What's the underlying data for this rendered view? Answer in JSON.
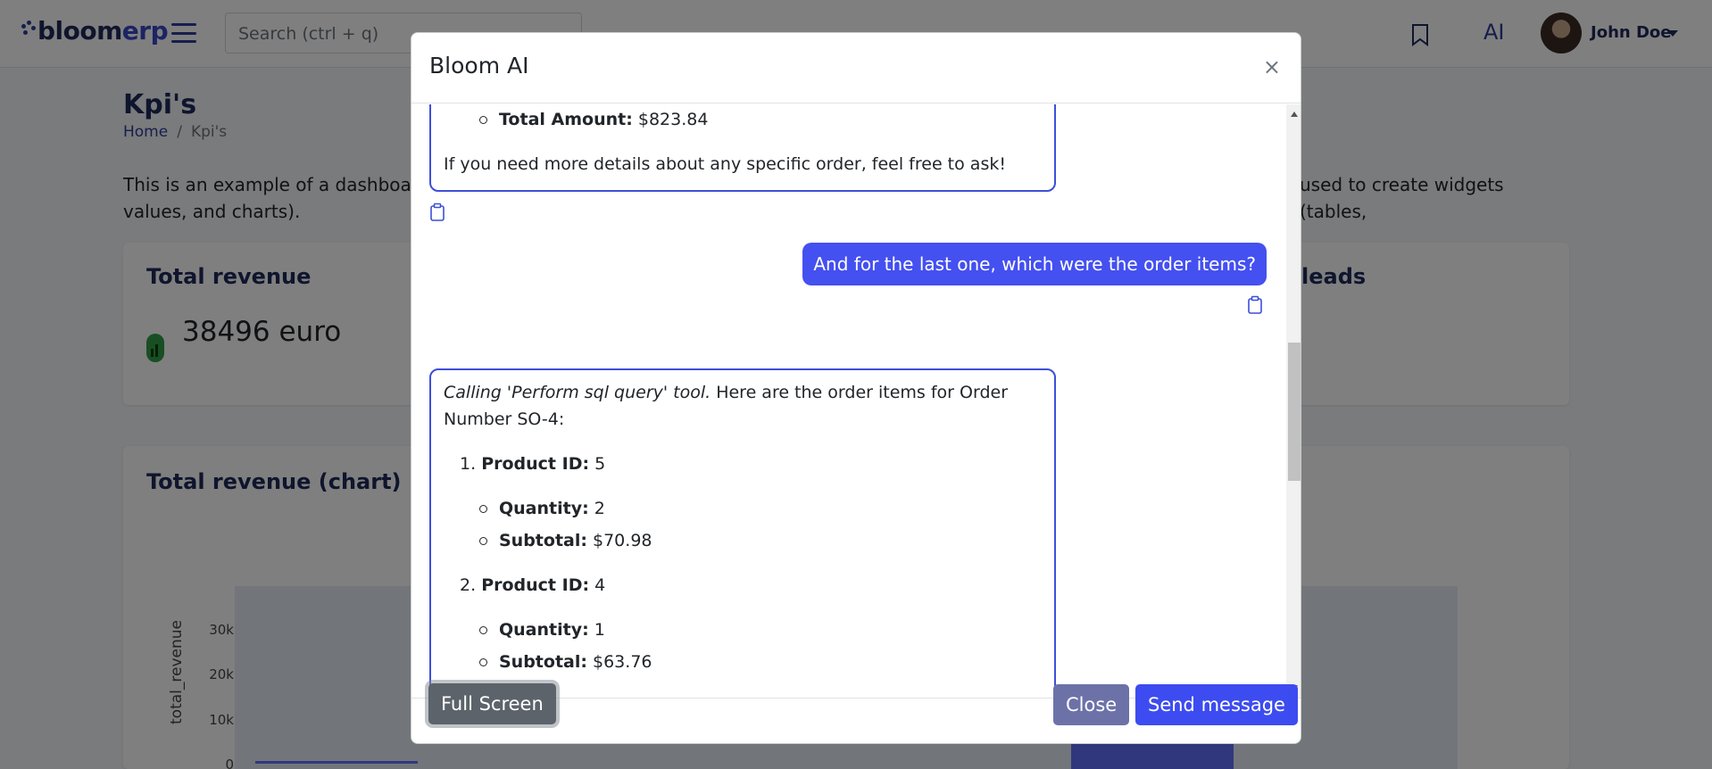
{
  "topbar": {
    "logo_main": "bloom",
    "logo_accent": "erp",
    "search_placeholder": "Search (ctrl + q)",
    "ai_label": "AI",
    "user_name": "John Doe"
  },
  "page": {
    "title": "Kpi's",
    "breadcrumb": [
      "Home",
      "/",
      "Kpi's"
    ],
    "intro_left": "This is an example of a dashboard",
    "intro_right": "used to create widgets (tables,",
    "intro_line2": "values, and charts)."
  },
  "cards": {
    "total_revenue_title": "Total revenue",
    "total_revenue_value": "38496 euro",
    "leads_title": "leads",
    "chart_title": "Total revenue (chart)"
  },
  "chart_data": {
    "type": "bar",
    "ylabel": "total_revenue",
    "yticks": [
      "30k",
      "20k",
      "10k",
      "0"
    ]
  },
  "modal": {
    "title": "Bloom AI",
    "close_symbol": "×",
    "msg1": {
      "amount_label": "Total Amount:",
      "amount_value": " $823.84",
      "closing": "If you need more details about any specific order, feel free to ask!"
    },
    "user_msg": "And for the last one, which were the order items?",
    "msg2": {
      "tool_call": "Calling 'Perform sql query' tool.",
      "intro": " Here are the order items for Order Number SO-4:",
      "items": [
        {
          "num": "1.",
          "product_label": "Product ID:",
          "product_id": " 5",
          "qty_label": "Quantity:",
          "qty": " 2",
          "subtotal_label": "Subtotal:",
          "subtotal": " $70.98"
        },
        {
          "num": "2.",
          "product_label": "Product ID:",
          "product_id": " 4",
          "qty_label": "Quantity:",
          "qty": " 1",
          "subtotal_label": "Subtotal:",
          "subtotal": " $63.76"
        }
      ]
    },
    "buttons": {
      "full_screen": "Full Screen",
      "close": "Close",
      "send": "Send message"
    }
  }
}
